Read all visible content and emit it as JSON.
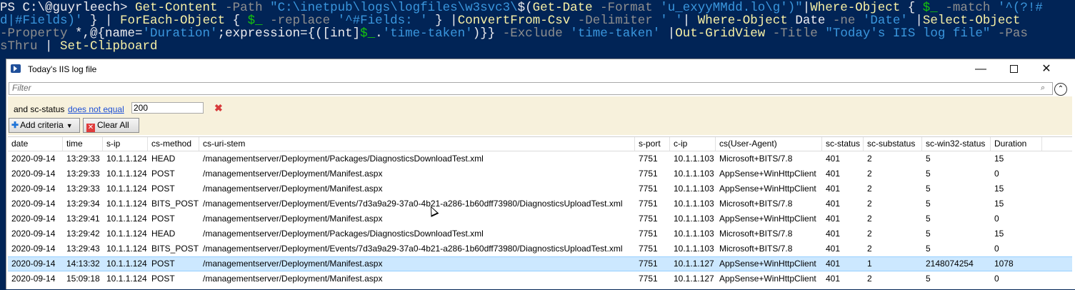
{
  "console": {
    "lines": [
      [
        {
          "t": "PS C:\\@guyrleech> ",
          "c": "k"
        },
        {
          "t": "Get-Content",
          "c": "y"
        },
        {
          "t": " -Path ",
          "c": "g"
        },
        {
          "t": "\"C:\\inetpub\\logs\\logfiles\\w3svc3\\",
          "c": "c"
        },
        {
          "t": "$(",
          "c": "k"
        },
        {
          "t": "Get-Date",
          "c": "y"
        },
        {
          "t": " -Format ",
          "c": "g"
        },
        {
          "t": "'u_exyyMMdd.lo\\g'",
          "c": "c"
        },
        {
          "t": ")\"",
          "c": "c"
        },
        {
          "t": "|",
          "c": "k"
        },
        {
          "t": "Where-Object",
          "c": "y"
        },
        {
          "t": " { ",
          "c": "k"
        },
        {
          "t": "$_",
          "c": "v"
        },
        {
          "t": " -match ",
          "c": "g"
        },
        {
          "t": "'^(?!#",
          "c": "c"
        }
      ],
      [
        {
          "t": "d|#Fields)'",
          "c": "c"
        },
        {
          "t": " } | ",
          "c": "k"
        },
        {
          "t": "ForEach-Object",
          "c": "y"
        },
        {
          "t": " { ",
          "c": "k"
        },
        {
          "t": "$_",
          "c": "v"
        },
        {
          "t": " -replace ",
          "c": "g"
        },
        {
          "t": "'^#Fields: '",
          "c": "c"
        },
        {
          "t": " } |",
          "c": "k"
        },
        {
          "t": "ConvertFrom-Csv",
          "c": "y"
        },
        {
          "t": " -Delimiter ",
          "c": "g"
        },
        {
          "t": "' '",
          "c": "c"
        },
        {
          "t": "| ",
          "c": "k"
        },
        {
          "t": "Where-Object",
          "c": "y"
        },
        {
          "t": " Date ",
          "c": "k"
        },
        {
          "t": "-ne ",
          "c": "g"
        },
        {
          "t": "'Date'",
          "c": "c"
        },
        {
          "t": " |",
          "c": "k"
        },
        {
          "t": "Select-Object",
          "c": "y"
        }
      ],
      [
        {
          "t": "-Property ",
          "c": "g"
        },
        {
          "t": "*,@{name=",
          "c": "k"
        },
        {
          "t": "'Duration'",
          "c": "c"
        },
        {
          "t": ";expression={([int]",
          "c": "k"
        },
        {
          "t": "$_",
          "c": "v"
        },
        {
          "t": ".",
          "c": "k"
        },
        {
          "t": "'time-taken'",
          "c": "c"
        },
        {
          "t": ")}} ",
          "c": "k"
        },
        {
          "t": "-Exclude ",
          "c": "g"
        },
        {
          "t": "'time-taken'",
          "c": "c"
        },
        {
          "t": " |",
          "c": "k"
        },
        {
          "t": "Out-GridView",
          "c": "y"
        },
        {
          "t": " -Title ",
          "c": "g"
        },
        {
          "t": "\"Today's IIS log file\"",
          "c": "c"
        },
        {
          "t": " -Pas",
          "c": "g"
        }
      ],
      [
        {
          "t": "sThru",
          "c": "g"
        },
        {
          "t": " | ",
          "c": "k"
        },
        {
          "t": "Set-Clipboard",
          "c": "y"
        }
      ]
    ]
  },
  "window": {
    "title": "Today's IIS log file",
    "minimize": "—",
    "close": "✕"
  },
  "filter": {
    "placeholder": "Filter",
    "search_icon": "⌕",
    "collapse_icon": "⌃"
  },
  "criteria": {
    "and_label": "and sc-status",
    "operator": "does not equal",
    "value": "200",
    "remove_icon": "✖"
  },
  "buttons": {
    "add_criteria": "Add criteria",
    "clear_all": "Clear All"
  },
  "table": {
    "columns": [
      "date",
      "time",
      "s-ip",
      "cs-method",
      "cs-uri-stem",
      "s-port",
      "c-ip",
      "cs(User-Agent)",
      "sc-status",
      "sc-substatus",
      "sc-win32-status",
      "Duration"
    ],
    "rows": [
      [
        "2020-09-14",
        "13:29:33",
        "10.1.1.124",
        "HEAD",
        "/managementserver/Deployment/Packages/DiagnosticsDownloadTest.xml",
        "7751",
        "10.1.1.103",
        "Microsoft+BITS/7.8",
        "401",
        "2",
        "5",
        "15"
      ],
      [
        "2020-09-14",
        "13:29:33",
        "10.1.1.124",
        "POST",
        "/managementserver/Deployment/Manifest.aspx",
        "7751",
        "10.1.1.103",
        "AppSense+WinHttpClient",
        "401",
        "2",
        "5",
        "0"
      ],
      [
        "2020-09-14",
        "13:29:33",
        "10.1.1.124",
        "POST",
        "/managementserver/Deployment/Manifest.aspx",
        "7751",
        "10.1.1.103",
        "AppSense+WinHttpClient",
        "401",
        "2",
        "5",
        "15"
      ],
      [
        "2020-09-14",
        "13:29:34",
        "10.1.1.124",
        "BITS_POST",
        "/managementserver/Deployment/Events/7d3a9a29-37a0-4b21-a286-1b60dff73980/DiagnosticsUploadTest.xml",
        "7751",
        "10.1.1.103",
        "Microsoft+BITS/7.8",
        "401",
        "2",
        "5",
        "15"
      ],
      [
        "2020-09-14",
        "13:29:41",
        "10.1.1.124",
        "POST",
        "/managementserver/Deployment/Manifest.aspx",
        "7751",
        "10.1.1.103",
        "AppSense+WinHttpClient",
        "401",
        "2",
        "5",
        "0"
      ],
      [
        "2020-09-14",
        "13:29:42",
        "10.1.1.124",
        "HEAD",
        "/managementserver/Deployment/Packages/DiagnosticsDownloadTest.xml",
        "7751",
        "10.1.1.103",
        "Microsoft+BITS/7.8",
        "401",
        "2",
        "5",
        "15"
      ],
      [
        "2020-09-14",
        "13:29:43",
        "10.1.1.124",
        "BITS_POST",
        "/managementserver/Deployment/Events/7d3a9a29-37a0-4b21-a286-1b60dff73980/DiagnosticsUploadTest.xml",
        "7751",
        "10.1.1.103",
        "Microsoft+BITS/7.8",
        "401",
        "2",
        "5",
        "0"
      ],
      [
        "2020-09-14",
        "14:13:32",
        "10.1.1.124",
        "POST",
        "/managementserver/Deployment/Manifest.aspx",
        "7751",
        "10.1.1.127",
        "AppSense+WinHttpClient",
        "401",
        "1",
        "2148074254",
        "1078"
      ],
      [
        "2020-09-14",
        "15:09:18",
        "10.1.1.124",
        "POST",
        "/managementserver/Deployment/Manifest.aspx",
        "7751",
        "10.1.1.127",
        "AppSense+WinHttpClient",
        "401",
        "2",
        "5",
        "0"
      ]
    ],
    "selected_row": 7
  }
}
